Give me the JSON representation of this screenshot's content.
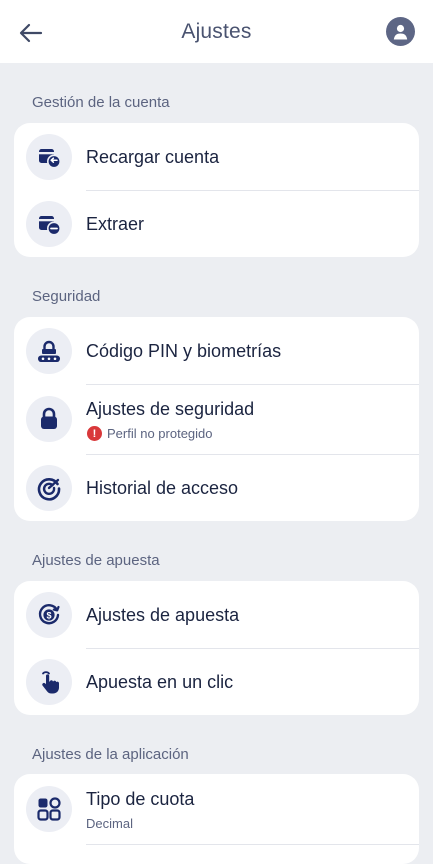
{
  "header": {
    "title": "Ajustes",
    "back_icon": "arrow-left-icon",
    "profile_icon": "user-circle-icon"
  },
  "colors": {
    "accent": "#1b2a6b",
    "background": "#eceef2",
    "warning": "#d9383a"
  },
  "sections": [
    {
      "title": "Gestión de la cuenta",
      "items": [
        {
          "label": "Recargar cuenta",
          "icon": "wallet-deposit-icon"
        },
        {
          "label": "Extraer",
          "icon": "wallet-withdraw-icon"
        }
      ]
    },
    {
      "title": "Seguridad",
      "items": [
        {
          "label": "Código PIN y biometrías",
          "icon": "pin-code-icon"
        },
        {
          "label": "Ajustes de seguridad",
          "icon": "lock-icon",
          "sub": "Perfil no protegido",
          "sub_icon": "warning-icon"
        },
        {
          "label": "Historial de acceso",
          "icon": "access-history-icon"
        }
      ]
    },
    {
      "title": "Ajustes de apuesta",
      "items": [
        {
          "label": "Ajustes de apuesta",
          "icon": "bet-settings-icon"
        },
        {
          "label": "Apuesta en un clic",
          "icon": "one-click-tap-icon"
        }
      ]
    },
    {
      "title": "Ajustes de la aplicación",
      "items": [
        {
          "label": "Tipo de cuota",
          "icon": "odds-grid-icon",
          "sub": "Decimal"
        }
      ]
    }
  ]
}
